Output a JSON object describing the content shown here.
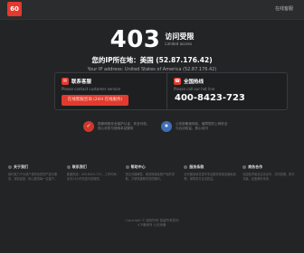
{
  "header": {
    "logo_text": "60",
    "top_link": "在线客服"
  },
  "hero": {
    "code": "403",
    "title_zh": "访问受限",
    "title_en": "Limited access",
    "ip_zh": "您的IP所在地：美国 (52.87.176.42)",
    "ip_en": "Your IP address: United States of America (52.87.176.42)"
  },
  "cards": {
    "service": {
      "title": "联系客服",
      "subtitle": "Please contact customer service",
      "button": "在线客服咨询 (24H 在线服务)"
    },
    "hotline": {
      "title": "全国热线",
      "subtitle": "Please call our hot line",
      "phone": "400-8423-723"
    }
  },
  "badges": [
    {
      "icon": "shield-icon",
      "text": "国家网络安全保护认证，安全可信，放心浏览与使用本站服务"
    },
    {
      "icon": "police-badge-icon",
      "text": "公安部备案网站，保障您的上网安全与合法权益，放心访问"
    }
  ],
  "footer": {
    "columns": [
      {
        "title": "关于我们",
        "text": "我们致力于为用户提供优质的产品与服务，诚信经营，用心服务每一位客户。"
      },
      {
        "title": "联系我们",
        "text": "客服热线：400-8423-723，工作时间：全天24小时在线为您服务。"
      },
      {
        "title": "帮助中心",
        "text": "常见问题解答、使用指南及账户相关帮助，方便快捷解决您的疑问。"
      },
      {
        "title": "服务条款",
        "text": "请仔细阅读并遵守本站服务条款及隐私政策，保障双方合法权益。"
      },
      {
        "title": "商务合作",
        "text": "欢迎各界朋友洽谈合作，共同发展，携手共赢，创造美好未来。"
      }
    ],
    "copyright_1": "Copyright © 版权所有 保留所有权利",
    "copyright_2": "ICP备案号 公安网备"
  }
}
